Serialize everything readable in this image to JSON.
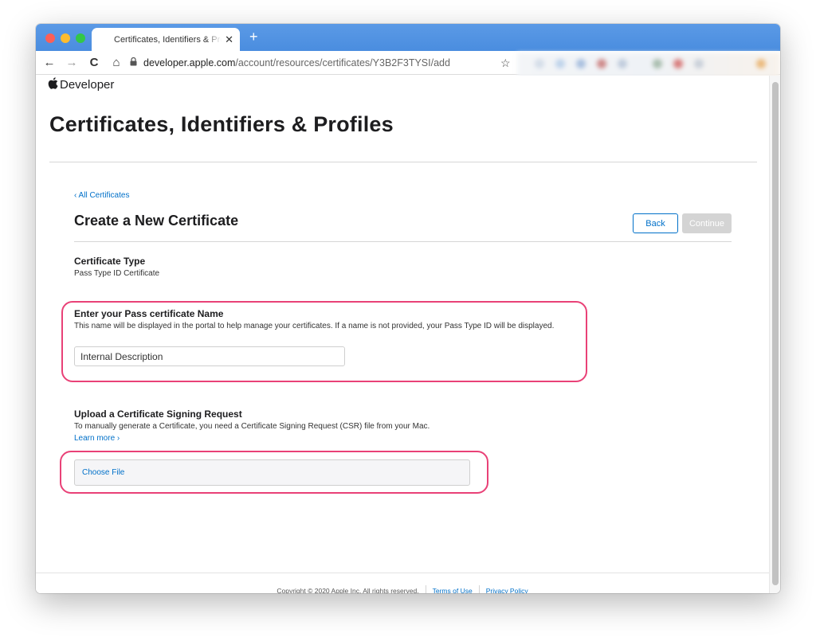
{
  "browser": {
    "tab_title": "Certificates, Identifiers & Profiles",
    "tab_close": "✕",
    "new_tab": "+",
    "address_host": "developer.apple.com",
    "address_path": "/account/resources/certificates/Y3B2F3TYSI/add",
    "nav": {
      "back": "←",
      "forward": "→",
      "reload": "C",
      "home": "⌂"
    },
    "bookmark_icon": "☆"
  },
  "site": {
    "brand": "Developer"
  },
  "page": {
    "title": "Certificates, Identifiers & Profiles",
    "back_link": "‹ All Certificates",
    "form_title": "Create a New Certificate",
    "buttons": {
      "back": "Back",
      "continue": "Continue"
    },
    "certificate_type": {
      "label": "Certificate Type",
      "value": "Pass Type ID Certificate"
    },
    "name_section": {
      "label": "Enter your Pass certificate Name",
      "help": "This name will be displayed in the portal to help manage your certificates. If a name is not provided, your Pass Type ID will be displayed.",
      "input_value": "Internal Description"
    },
    "csr_section": {
      "label": "Upload a Certificate Signing Request",
      "help": "To manually generate a Certificate, you need a Certificate Signing Request (CSR) file from your Mac.",
      "learn_more": "Learn more ›",
      "choose_file": "Choose File"
    }
  },
  "footer": {
    "copyright": "Copyright © 2020 Apple Inc. All rights reserved.",
    "terms": "Terms of Use",
    "privacy": "Privacy Policy"
  },
  "colors": {
    "link": "#0070c9",
    "highlight": "#e94177",
    "tabbar": "#4a8ddf"
  }
}
